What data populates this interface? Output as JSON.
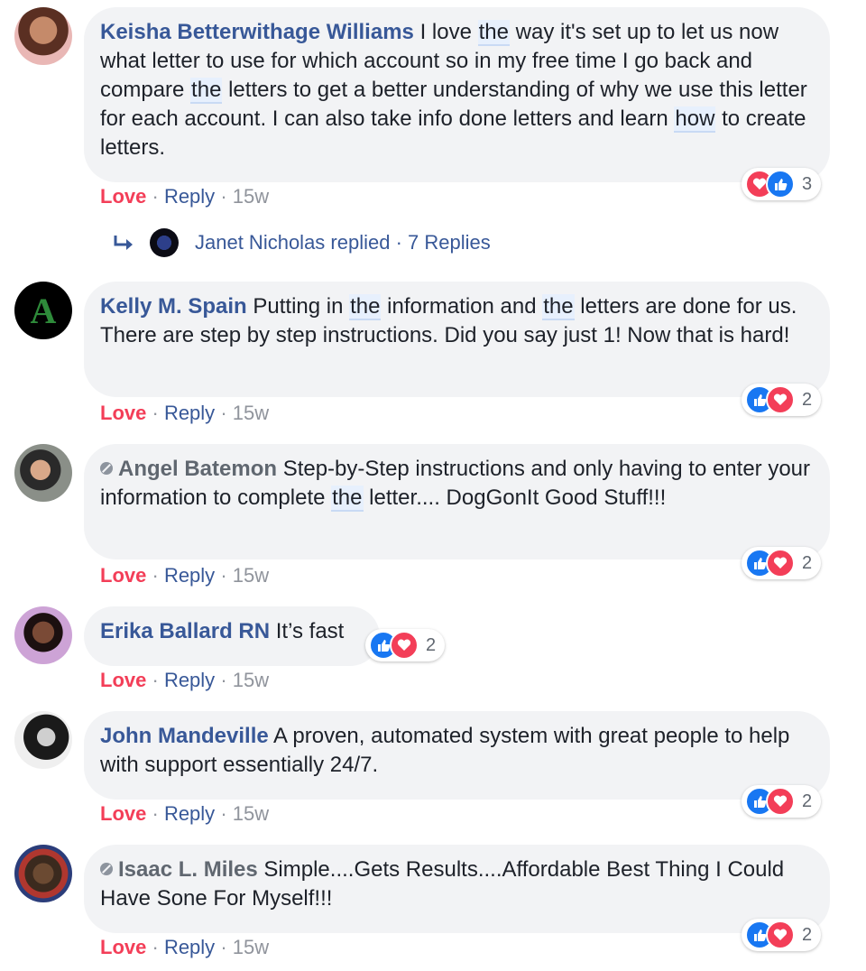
{
  "comments": [
    {
      "author": "Keisha Betterwithage Williams",
      "text_parts": [
        "I love ",
        "the",
        " way it's set up to let us now what letter to use for which account so in my free time I go back and compare ",
        "the",
        " letters to get a better understanding of why we use this letter for each account. I can also take info done letters and learn ",
        "how",
        " to create letters."
      ],
      "love": "Love",
      "reply": "Reply",
      "time": "15w",
      "reaction_count": "3",
      "replies_text": "Janet Nicholas replied · 7 Replies"
    },
    {
      "author": "Kelly M. Spain",
      "text_parts": [
        "Putting in ",
        "the",
        " information and ",
        "the",
        " letters are done for us. There are step by step instructions. Did you say just 1! Now that is hard!"
      ],
      "love": "Love",
      "reply": "Reply",
      "time": "15w",
      "reaction_count": "2"
    },
    {
      "author": "Angel Batemon",
      "text_parts": [
        "Step-by-Step instructions and only having to enter your information to complete ",
        "the",
        " letter.... DogGonIt Good Stuff!!!"
      ],
      "love": "Love",
      "reply": "Reply",
      "time": "15w",
      "reaction_count": "2"
    },
    {
      "author": "Erika Ballard RN",
      "text_parts": [
        "It’s fast"
      ],
      "love": "Love",
      "reply": "Reply",
      "time": "15w",
      "reaction_count": "2"
    },
    {
      "author": "John Mandeville",
      "text_parts": [
        "A proven, automated system with great people to help with support essentially 24/7."
      ],
      "love": "Love",
      "reply": "Reply",
      "time": "15w",
      "reaction_count": "2"
    },
    {
      "author": "Isaac L. Miles",
      "text_parts": [
        "Simple....Gets Results....Affordable Best Thing I Could Have Sone For Myself!!!"
      ],
      "love": "Love",
      "reply": "Reply",
      "time": "15w",
      "reaction_count": "2"
    }
  ],
  "separator": "·",
  "colors": {
    "link": "#385898",
    "love": "#f33e58",
    "like": "#1877f2",
    "bubble": "#f2f3f5",
    "meta": "#90949c"
  },
  "icons": [
    "reply-arrow-icon",
    "like-icon",
    "love-icon",
    "unavailable-icon"
  ]
}
